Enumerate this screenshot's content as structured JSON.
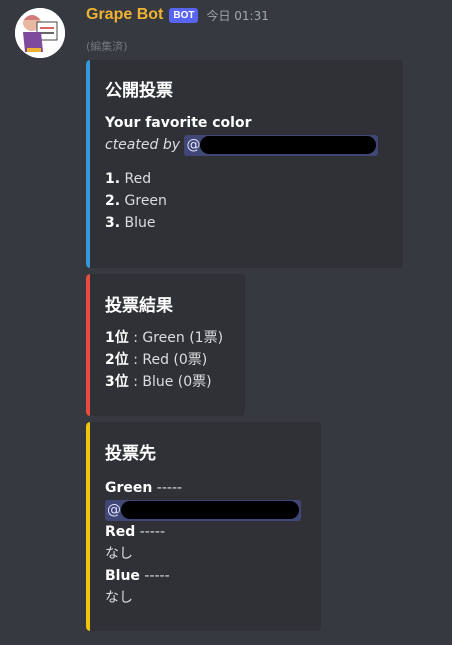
{
  "message": {
    "username": "Grape Bot",
    "badge": "BOT",
    "timestamp": "今日 01:31",
    "edited": "(編集済)"
  },
  "colors": {
    "poll_bar": "#3498db",
    "result_bar": "#e74c3c",
    "voters_bar": "#f1c40f",
    "username": "#f0b232",
    "badge": "#5865f2"
  },
  "poll_embed": {
    "title": "公開投票",
    "question": "Your favorite color",
    "creator_prefix": "cteated by",
    "mention_at": "@",
    "options": [
      {
        "num": "1.",
        "label": "Red"
      },
      {
        "num": "2.",
        "label": "Green"
      },
      {
        "num": "3.",
        "label": "Blue"
      }
    ]
  },
  "result_embed": {
    "title": "投票結果",
    "rows": [
      {
        "rank": "1位",
        "text": ": Green (1票)"
      },
      {
        "rank": "2位",
        "text": ": Red (0票)"
      },
      {
        "rank": "3位",
        "text": ": Blue (0票)"
      }
    ]
  },
  "voters_embed": {
    "title": "投票先",
    "groups": [
      {
        "color": "Green",
        "sep": " -----",
        "mention_at": "@"
      },
      {
        "color": "Red",
        "sep": " -----",
        "value": "なし"
      },
      {
        "color": "Blue",
        "sep": " -----",
        "value": "なし"
      }
    ]
  }
}
